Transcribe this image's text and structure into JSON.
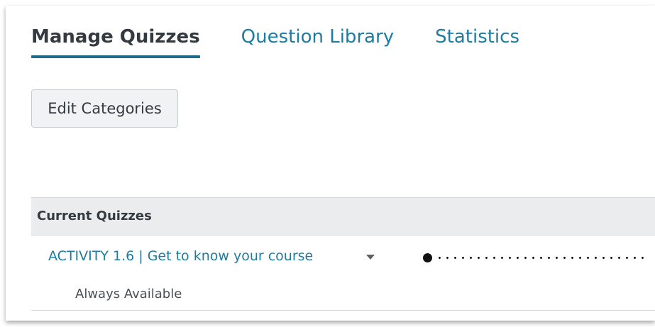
{
  "tabs": [
    {
      "label": "Manage Quizzes",
      "active": true
    },
    {
      "label": "Question Library",
      "active": false
    },
    {
      "label": "Statistics",
      "active": false
    }
  ],
  "toolbar": {
    "edit_categories_label": "Edit Categories"
  },
  "table": {
    "header": "Current Quizzes",
    "rows": [
      {
        "title": "ACTIVITY 1.6 | Get to know your course",
        "availability": "Always Available"
      }
    ]
  },
  "colors": {
    "link": "#1d7ca4",
    "active_tab_underline": "#1d6a8c",
    "header_bg": "#ebeced"
  },
  "icons": {
    "quiz_menu": "chevron-down-icon"
  }
}
